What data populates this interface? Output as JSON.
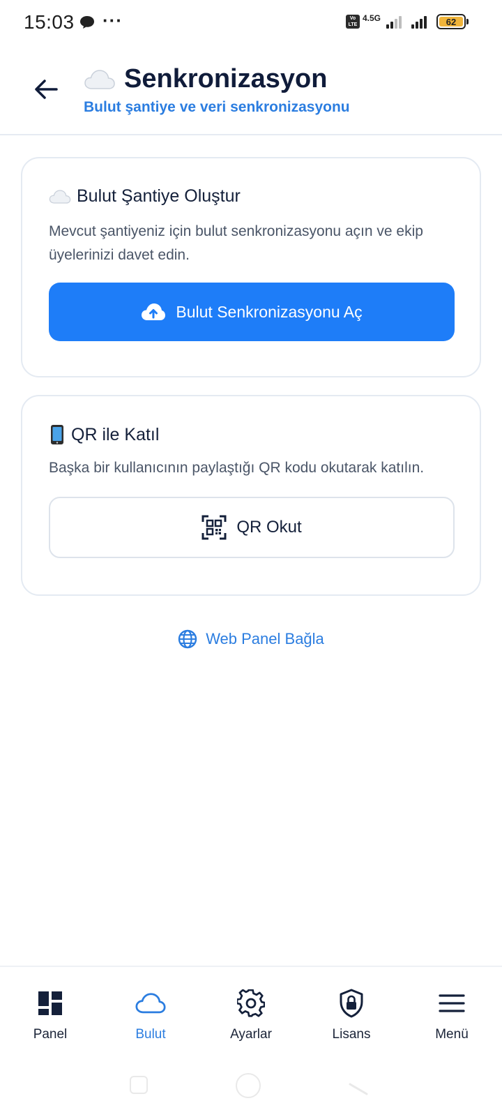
{
  "status_bar": {
    "time": "15:03",
    "more": "···",
    "network": "4.5G",
    "battery": "62",
    "battery_color": "#f0b43a"
  },
  "header": {
    "back_icon": "arrow-left-icon",
    "title": "Senkronizasyon",
    "title_icon": "cloud-emoji-icon",
    "subtitle": "Bulut şantiye ve veri senkronizasyonu"
  },
  "cloud_card": {
    "icon": "cloud-emoji-icon",
    "title": "Bulut Şantiye Oluştur",
    "description": "Mevcut şantiyeniz için bulut senkronizasyonu açın ve ekip üyelerinizi davet edin.",
    "button_icon": "cloud-upload-icon",
    "button_label": "Bulut Senkronizasyonu Aç",
    "button_color": "#1e7df8"
  },
  "qr_card": {
    "icon": "mobile-phone-icon",
    "title": "QR ile Katıl",
    "description": "Başka bir kullanıcının paylaştığı QR kodu okutarak katılın.",
    "button_icon": "qr-scan-icon",
    "button_label": "QR Okut"
  },
  "web_link": {
    "icon": "globe-icon",
    "label": "Web Panel Bağla",
    "color": "#2b7de0"
  },
  "bottom_nav": {
    "items": [
      {
        "label": "Panel",
        "icon": "dashboard-icon",
        "active": false
      },
      {
        "label": "Bulut",
        "icon": "cloud-icon",
        "active": true
      },
      {
        "label": "Ayarlar",
        "icon": "gear-icon",
        "active": false
      },
      {
        "label": "Lisans",
        "icon": "shield-lock-icon",
        "active": false
      },
      {
        "label": "Menü",
        "icon": "hamburger-menu-icon",
        "active": false
      }
    ]
  }
}
